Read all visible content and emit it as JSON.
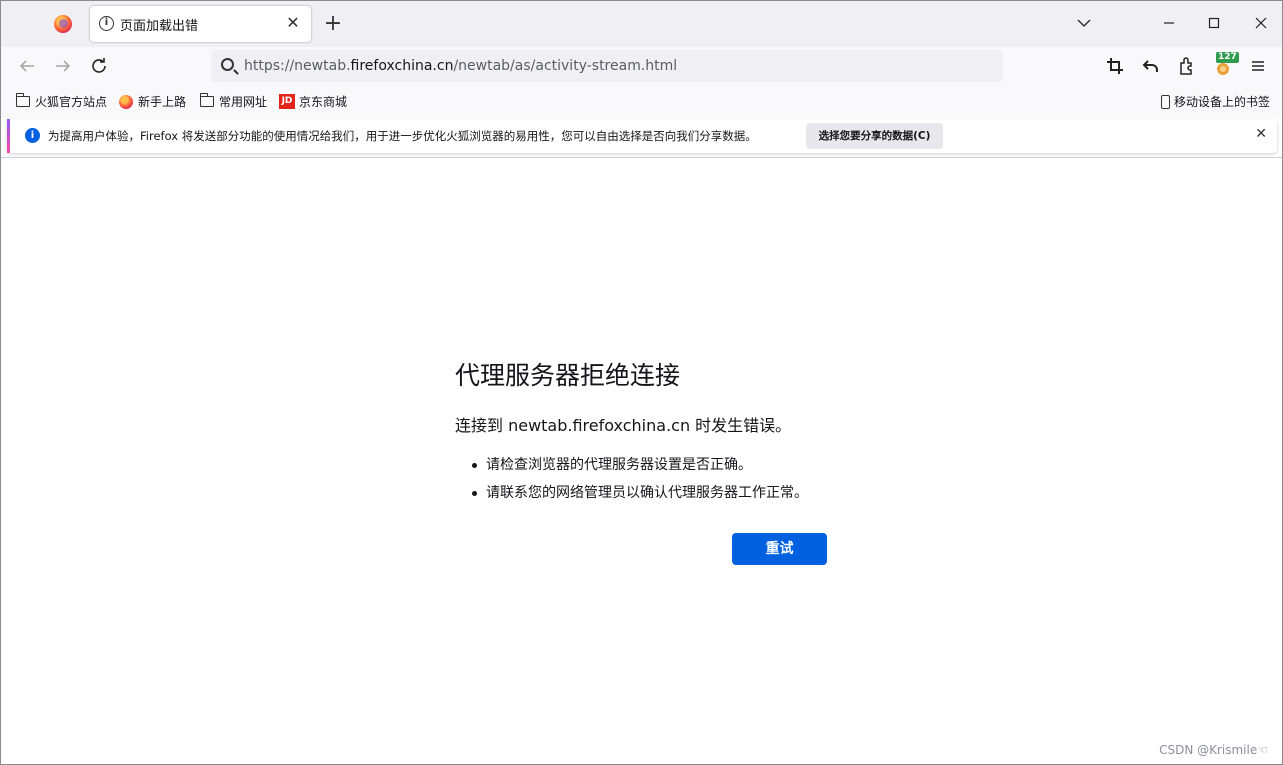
{
  "browser": {
    "tab": {
      "title": "页面加载出错",
      "close": "✕"
    },
    "new_tab": "+",
    "window_controls": {
      "list_all_tabs": "⌄",
      "minimize": "—",
      "maximize": "☐",
      "close": "✕"
    }
  },
  "navbar": {
    "url_prefix": "https://newtab.",
    "url_host": "firefoxchina.cn",
    "url_path": "/newtab/as/activity-stream.html",
    "extension_badge": "127"
  },
  "bookmarks": {
    "items": [
      {
        "label": "火狐官方站点",
        "icon": "folder-icon"
      },
      {
        "label": "新手上路",
        "icon": "firefox-icon"
      },
      {
        "label": "常用网址",
        "icon": "folder-icon"
      },
      {
        "label": "京东商城",
        "icon": "jd-icon",
        "icon_text": "JD"
      }
    ],
    "mobile": "移动设备上的书签"
  },
  "notification": {
    "text": "为提高用户体验，Firefox 将发送部分功能的使用情况给我们，用于进一步优化火狐浏览器的易用性，您可以自由选择是否向我们分享数据。",
    "button": "选择您要分享的数据(C)"
  },
  "error": {
    "title": "代理服务器拒绝连接",
    "description": "连接到 newtab.firefoxchina.cn 时发生错误。",
    "hints": [
      "请检查浏览器的代理服务器设置是否正确。",
      "请联系您的网络管理员以确认代理服务器工作正常。"
    ],
    "retry_button": "重试"
  },
  "watermark": "CSDN @Krismile☜",
  "colors": {
    "accent": "#0061e0",
    "info": "#0060df"
  }
}
